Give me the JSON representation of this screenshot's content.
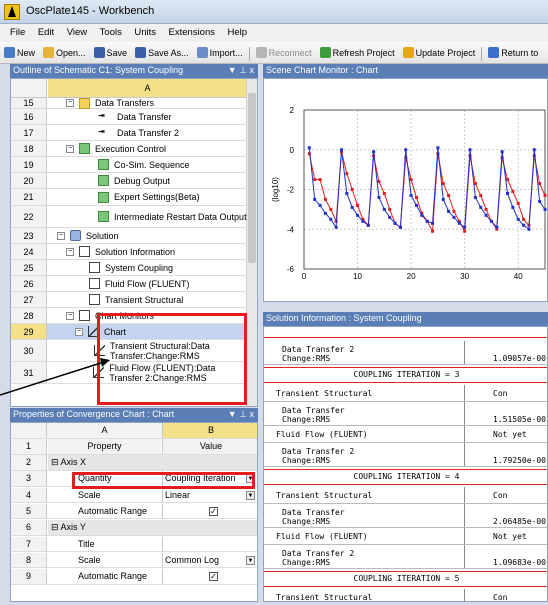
{
  "window": {
    "title": "OscPlate145 - Workbench"
  },
  "menu": [
    "File",
    "Edit",
    "View",
    "Tools",
    "Units",
    "Extensions",
    "Help"
  ],
  "toolbar": [
    {
      "label": "New",
      "icon": "new-icon",
      "color": "#4a7bc8"
    },
    {
      "label": "Open...",
      "icon": "open-folder-icon",
      "color": "#e5b53b"
    },
    {
      "label": "Save",
      "icon": "save-icon",
      "color": "#3b5fa8"
    },
    {
      "label": "Save As...",
      "icon": "save-as-icon",
      "color": "#3b5fa8"
    },
    {
      "label": "Import...",
      "icon": "import-icon",
      "color": "#6b8cc6"
    },
    {
      "label": "Reconnect",
      "icon": "reconnect-icon",
      "color": "#b5b5b5"
    },
    {
      "label": "Refresh Project",
      "icon": "refresh-icon",
      "color": "#3f9b3f"
    },
    {
      "label": "Update Project",
      "icon": "update-lightning-icon",
      "color": "#e6a817"
    },
    {
      "label": "Return to",
      "icon": "return-icon",
      "color": "#3b6ec8"
    }
  ],
  "outline": {
    "header": "Outline of Schematic C1: System Coupling",
    "header_btns": "▼ ⊥ x",
    "column": "A",
    "rows": [
      {
        "num": "15",
        "label": "Data Transfers",
        "icon": "folder",
        "indent": 2,
        "exp": "⊟"
      },
      {
        "num": "16",
        "label": "Data Transfer",
        "icon": "arrow",
        "indent": 4
      },
      {
        "num": "17",
        "label": "Data Transfer 2",
        "icon": "arrow",
        "indent": 4
      },
      {
        "num": "18",
        "label": "Execution Control",
        "icon": "green",
        "indent": 2,
        "exp": "⊟"
      },
      {
        "num": "19",
        "label": "Co-Sim. Sequence",
        "icon": "green",
        "indent": 4
      },
      {
        "num": "20",
        "label": "Debug Output",
        "icon": "green",
        "indent": 4
      },
      {
        "num": "21",
        "label": "Expert Settings(Beta)",
        "icon": "green",
        "indent": 4
      },
      {
        "num": "22",
        "label": "Intermediate Restart Data Output",
        "icon": "green",
        "indent": 4
      },
      {
        "num": "23",
        "label": "Solution",
        "icon": "sol",
        "indent": 1,
        "exp": "⊟"
      },
      {
        "num": "24",
        "label": "Solution Information",
        "icon": "doc",
        "indent": 2,
        "exp": "⊟"
      },
      {
        "num": "25",
        "label": "System Coupling",
        "icon": "doc",
        "indent": 3
      },
      {
        "num": "26",
        "label": "Fluid Flow (FLUENT)",
        "icon": "doc",
        "indent": 3
      },
      {
        "num": "27",
        "label": "Transient Structural",
        "icon": "doc",
        "indent": 3
      },
      {
        "num": "28",
        "label": "Chart Monitors",
        "icon": "doc",
        "indent": 2,
        "exp": "⊟"
      },
      {
        "num": "29",
        "label": "Chart",
        "icon": "chart",
        "indent": 3,
        "exp": "⊟",
        "selected": true
      },
      {
        "num": "30",
        "label": "Transient Structural:Data Transfer:Change:RMS",
        "icon": "chart",
        "indent": 4
      },
      {
        "num": "31",
        "label": "Fluid Flow (FLUENT):Data Transfer 2:Change:RMS",
        "icon": "chart",
        "indent": 4
      }
    ]
  },
  "properties": {
    "header": "Properties of Convergence Chart : Chart",
    "header_btns": "▼ ⊥ x",
    "col_a": "A",
    "col_b": "B",
    "hdr_property": "Property",
    "hdr_value": "Value",
    "rows": [
      {
        "num": "2",
        "type": "group",
        "label": "Axis X"
      },
      {
        "num": "3",
        "label": "Quantity",
        "value": "Coupling Iteration",
        "dropdown": true
      },
      {
        "num": "4",
        "label": "Scale",
        "value": "Linear",
        "dropdown": true
      },
      {
        "num": "5",
        "label": "Automatic Range",
        "value": "✓",
        "check": true
      },
      {
        "num": "6",
        "type": "group",
        "label": "Axis Y"
      },
      {
        "num": "7",
        "label": "Title",
        "value": ""
      },
      {
        "num": "8",
        "label": "Scale",
        "value": "Common Log",
        "dropdown": true
      },
      {
        "num": "9",
        "label": "Automatic Range",
        "value": "✓",
        "check": true
      }
    ]
  },
  "chart_panel": {
    "header": "Scene Chart Monitor : Chart"
  },
  "chart_data": {
    "type": "line",
    "ylabel": "(log10)",
    "xlim": [
      0,
      45
    ],
    "ylim": [
      -6,
      2
    ],
    "xticks": [
      0,
      10,
      20,
      30,
      40
    ],
    "yticks": [
      2,
      0,
      -2,
      -4,
      -6
    ],
    "grid": true,
    "series": [
      {
        "color": "#e02020",
        "x": [
          1,
          2,
          3,
          4,
          5,
          6,
          7,
          8,
          9,
          10,
          11,
          12,
          13,
          14,
          15,
          16,
          17,
          18,
          19,
          20,
          21,
          22,
          23,
          24,
          25,
          26,
          27,
          28,
          29,
          30,
          31,
          32,
          33,
          34,
          35,
          36,
          37,
          38,
          39,
          40,
          41,
          42,
          43,
          44,
          45
        ],
        "y": [
          -0.2,
          -1.5,
          -1.5,
          -2.5,
          -3.0,
          -3.6,
          -0.1,
          -1.2,
          -2.0,
          -2.8,
          -3.5,
          -3.8,
          -0.3,
          -1.6,
          -2.2,
          -3.0,
          -3.7,
          -3.9,
          -0.4,
          -1.5,
          -2.4,
          -3.2,
          -3.6,
          -4.1,
          -0.2,
          -1.7,
          -2.3,
          -3.1,
          -3.6,
          -4.1,
          -0.3,
          -1.7,
          -2.3,
          -3.0,
          -3.6,
          -4.0,
          -0.4,
          -1.5,
          -2.1,
          -2.7,
          -3.5,
          -3.8,
          -0.3,
          -1.7,
          -2.3
        ]
      },
      {
        "color": "#2030c8",
        "x": [
          1,
          2,
          3,
          4,
          5,
          6,
          7,
          8,
          9,
          10,
          11,
          12,
          13,
          14,
          15,
          16,
          17,
          18,
          19,
          20,
          21,
          22,
          23,
          24,
          25,
          26,
          27,
          28,
          29,
          30,
          31,
          32,
          33,
          34,
          35,
          36,
          37,
          38,
          39,
          40,
          41,
          42,
          43,
          44,
          45
        ],
        "y": [
          0.1,
          -2.5,
          -2.8,
          -3.2,
          -3.5,
          -3.9,
          0.0,
          -2.2,
          -2.9,
          -3.3,
          -3.6,
          -3.8,
          -0.1,
          -2.4,
          -3.0,
          -3.4,
          -3.7,
          -3.9,
          0.0,
          -2.3,
          -2.8,
          -3.3,
          -3.6,
          -3.7,
          0.1,
          -2.5,
          -3.1,
          -3.4,
          -3.7,
          -3.9,
          0.0,
          -2.4,
          -2.9,
          -3.3,
          -3.6,
          -3.9,
          -0.1,
          -2.2,
          -2.9,
          -3.5,
          -3.8,
          -4.0,
          0.0,
          -2.6,
          -3.0
        ]
      }
    ]
  },
  "solution_info": {
    "header": "Solution Information : System Coupling",
    "lines": [
      {
        "kind": "row",
        "label": "Data Transfer 2\nChange:RMS",
        "value": "1.09057e-00"
      },
      {
        "kind": "iter",
        "text": "COUPLING ITERATION = 3"
      },
      {
        "kind": "row",
        "label": "Transient Structural",
        "value": "Con",
        "top": true
      },
      {
        "kind": "row",
        "label": "Data Transfer\nChange:RMS",
        "value": "1.51505e-00"
      },
      {
        "kind": "row",
        "label": "Fluid Flow (FLUENT)",
        "value": "Not yet",
        "top": true
      },
      {
        "kind": "row",
        "label": "Data Transfer 2\nChange:RMS",
        "value": "1.79250e-00"
      },
      {
        "kind": "iter",
        "text": "COUPLING ITERATION = 4"
      },
      {
        "kind": "row",
        "label": "Transient Structural",
        "value": "Con",
        "top": true
      },
      {
        "kind": "row",
        "label": "Data Transfer\nChange:RMS",
        "value": "2.06485e-00"
      },
      {
        "kind": "row",
        "label": "Fluid Flow (FLUENT)",
        "value": "Not yet",
        "top": true
      },
      {
        "kind": "row",
        "label": "Data Transfer 2\nChange:RMS",
        "value": "1.09683e-00"
      },
      {
        "kind": "iter",
        "text": "COUPLING ITERATION = 5"
      },
      {
        "kind": "row",
        "label": "Transient Structural",
        "value": "Con",
        "top": true
      }
    ]
  },
  "colors": {
    "accent_red": "#e31d1d",
    "panel_header": "#5a7eb5",
    "selection": "#f5e08a"
  }
}
